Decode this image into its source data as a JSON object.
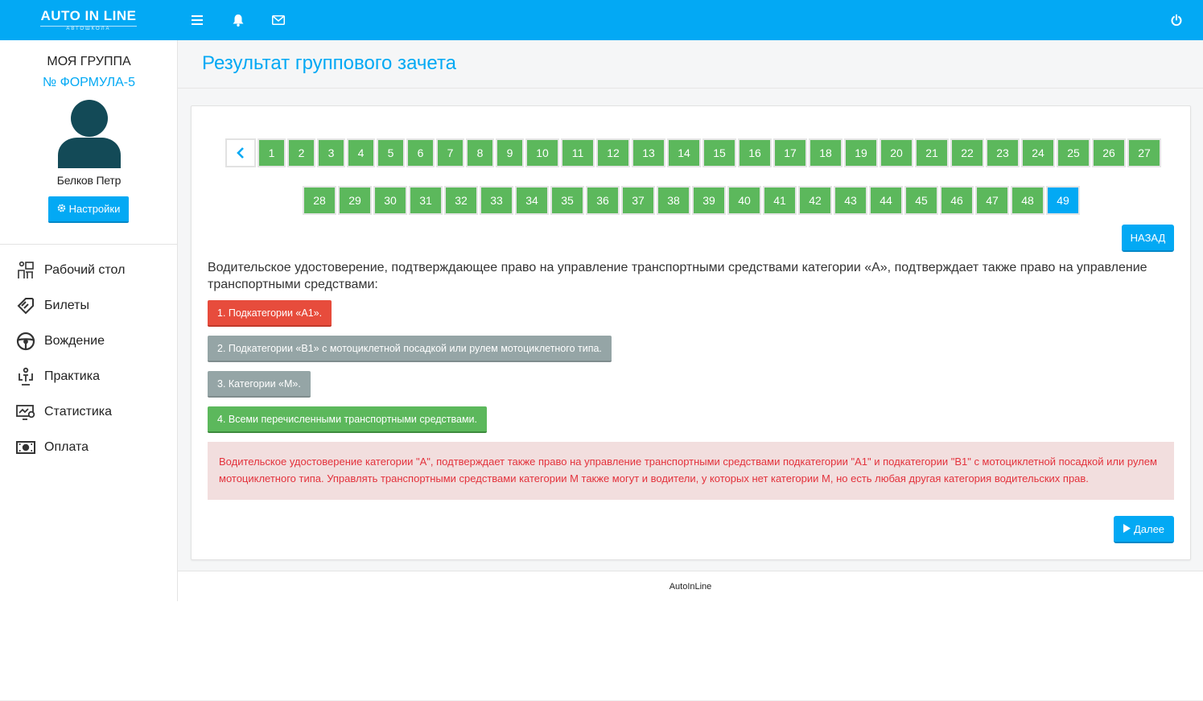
{
  "brand": {
    "name": "AUTO IN LINE",
    "subtitle": "АВТОШКОЛА"
  },
  "colors": {
    "accent": "#03a9f4",
    "correct": "#5cb85c",
    "wrong": "#e74c3c",
    "neutral": "#95a5a6",
    "explain_bg": "#f2dede",
    "explain_text": "#e3323c"
  },
  "topbar": {
    "icons": [
      "menu-icon",
      "bell-icon",
      "envelope-icon",
      "power-icon"
    ]
  },
  "sidebar": {
    "group_title": "МОЯ ГРУППА",
    "group_name": "№ ФОРМУЛА-5",
    "user_name": "Белков Петр",
    "settings_label": "Настройки",
    "items": [
      {
        "label": "Рабочий стол",
        "icon": "desk-icon"
      },
      {
        "label": "Билеты",
        "icon": "ticket-icon"
      },
      {
        "label": "Вождение",
        "icon": "steering-wheel-icon"
      },
      {
        "label": "Практика",
        "icon": "practice-icon"
      },
      {
        "label": "Статистика",
        "icon": "statistics-icon"
      },
      {
        "label": "Оплата",
        "icon": "money-icon"
      }
    ]
  },
  "page": {
    "title": "Результат группового зачета"
  },
  "pagination": {
    "pages": [
      "1",
      "2",
      "3",
      "4",
      "5",
      "6",
      "7",
      "8",
      "9",
      "10",
      "11",
      "12",
      "13",
      "14",
      "15",
      "16",
      "17",
      "18",
      "19",
      "20",
      "21",
      "22",
      "23",
      "24",
      "25",
      "26",
      "27",
      "28",
      "29",
      "30",
      "31",
      "32",
      "33",
      "34",
      "35",
      "36",
      "37",
      "38",
      "39",
      "40",
      "41",
      "42",
      "43",
      "44",
      "45",
      "46",
      "47",
      "48",
      "49"
    ],
    "current": "49"
  },
  "back_label": "НАЗАД",
  "question": {
    "text": "Водительское удостоверение, подтверждающее право на управление транспортными средствами категории «А», подтверждает также право на управление транспортными средствами:",
    "answers": [
      {
        "label": "1. Подкатегории «А1».",
        "state": "wrong"
      },
      {
        "label": "2. Подкатегории «В1» с мотоциклетной посадкой или рулем мотоциклетного типа.",
        "state": "neutral"
      },
      {
        "label": "3. Категории «М».",
        "state": "neutral"
      },
      {
        "label": "4. Всеми перечисленными транспортными средствами.",
        "state": "correct"
      }
    ],
    "explanation": "Водительское удостоверение категории \"А\", подтверждает также право на управление транспортными средствами подкатегории \"А1\" и подкатегории \"В1\" с мотоциклетной посадкой или рулем мотоциклетного типа. Управлять транспортными средствами категории М также могут и водители, у которых нет категории М, но есть любая другая категория водительских прав."
  },
  "next_label": "Далее",
  "footer": {
    "text": "AutoInLine"
  }
}
